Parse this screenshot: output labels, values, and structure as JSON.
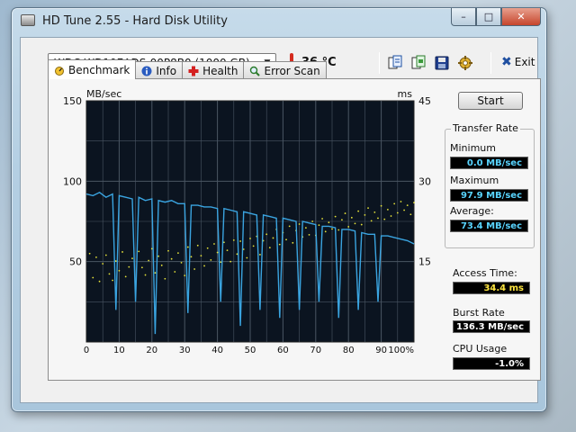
{
  "window": {
    "title": "HD Tune 2.55 - Hard Disk Utility",
    "controls": {
      "minimize": "–",
      "maximize": "□",
      "close": "✕"
    }
  },
  "toolbar": {
    "drive": "WDC WD10EADS-00P8B0 (1000 GB)",
    "temperature": "36 °C",
    "icons": [
      "copy-text-icon",
      "copy-screenshot-icon",
      "save-icon",
      "options-icon"
    ],
    "exit_label": "Exit"
  },
  "tabs": [
    {
      "label": "Benchmark",
      "icon": "benchmark-icon",
      "active": true
    },
    {
      "label": "Info",
      "icon": "info-icon",
      "active": false
    },
    {
      "label": "Health",
      "icon": "health-icon",
      "active": false
    },
    {
      "label": "Error Scan",
      "icon": "error-scan-icon",
      "active": false
    }
  ],
  "benchmark": {
    "start_label": "Start",
    "transfer_rate": {
      "title": "Transfer Rate",
      "minimum_label": "Minimum",
      "minimum_value": "0.0 MB/sec",
      "maximum_label": "Maximum",
      "maximum_value": "97.9 MB/sec",
      "average_label": "Average:",
      "average_value": "73.4 MB/sec"
    },
    "access_time_label": "Access Time:",
    "access_time_value": "34.4 ms",
    "burst_rate_label": "Burst Rate",
    "burst_rate_value": "136.3 MB/sec",
    "cpu_usage_label": "CPU Usage",
    "cpu_usage_value": "-1.0%"
  },
  "colors": {
    "plot_bg": "#0b1420",
    "grid": "#4a5663",
    "transfer_line": "#3aa4e0",
    "access_dots": "#e6e23a",
    "value_cyan": "#58d4ff",
    "value_yellow": "#ffe640",
    "value_white": "#ffffff"
  },
  "chart_data": {
    "type": "line",
    "left_axis_unit": "MB/sec",
    "right_axis_unit": "ms",
    "left_ticks": [
      "150",
      "100",
      "50"
    ],
    "right_ticks": [
      "45",
      "30",
      "15"
    ],
    "x_ticks": [
      "0",
      "10",
      "20",
      "30",
      "40",
      "50",
      "60",
      "70",
      "80",
      "90",
      "100%"
    ],
    "xlim": [
      0,
      100
    ],
    "ylim": [
      0,
      150
    ],
    "y2lim": [
      0,
      45
    ],
    "grid": true,
    "series": [
      {
        "x": [
          0,
          2,
          4,
          6,
          8,
          9,
          10,
          12,
          14,
          15,
          16,
          18,
          20,
          21,
          22,
          24,
          26,
          28,
          30,
          31,
          32,
          34,
          36,
          38,
          40,
          41,
          42,
          44,
          46,
          47,
          48,
          50,
          52,
          53,
          54,
          56,
          58,
          59,
          60,
          62,
          64,
          65,
          66,
          68,
          70,
          71,
          72,
          74,
          76,
          77,
          78,
          80,
          82,
          83,
          84,
          86,
          88,
          89,
          90,
          92,
          94,
          96,
          98,
          100
        ],
        "values": [
          92,
          91,
          93,
          90,
          92,
          20,
          91,
          90,
          89,
          25,
          90,
          88,
          89,
          5,
          88,
          87,
          88,
          86,
          86,
          18,
          85,
          85,
          84,
          84,
          83,
          25,
          83,
          82,
          81,
          10,
          81,
          80,
          79,
          20,
          79,
          78,
          77,
          15,
          77,
          76,
          75,
          20,
          75,
          74,
          73,
          25,
          72,
          72,
          71,
          15,
          70,
          70,
          69,
          20,
          68,
          67,
          67,
          25,
          66,
          66,
          65,
          64,
          63,
          61
        ]
      },
      {
        "points": [
          [
            1,
            16.5
          ],
          [
            2,
            12.0
          ],
          [
            3,
            15.8
          ],
          [
            4,
            11.3
          ],
          [
            5,
            14.6
          ],
          [
            6,
            16.2
          ],
          [
            7,
            12.7
          ],
          [
            8,
            11.5
          ],
          [
            9,
            15.1
          ],
          [
            10,
            13.3
          ],
          [
            11,
            16.8
          ],
          [
            12,
            12.2
          ],
          [
            13,
            14.0
          ],
          [
            14,
            15.6
          ],
          [
            15,
            11.0
          ],
          [
            16,
            16.9
          ],
          [
            17,
            13.9
          ],
          [
            18,
            12.5
          ],
          [
            19,
            15.2
          ],
          [
            20,
            17.4
          ],
          [
            21,
            12.9
          ],
          [
            22,
            16.0
          ],
          [
            23,
            14.3
          ],
          [
            24,
            11.8
          ],
          [
            25,
            17.0
          ],
          [
            26,
            15.5
          ],
          [
            27,
            13.1
          ],
          [
            28,
            16.6
          ],
          [
            29,
            14.8
          ],
          [
            30,
            12.4
          ],
          [
            31,
            17.7
          ],
          [
            32,
            15.9
          ],
          [
            33,
            13.6
          ],
          [
            34,
            18.0
          ],
          [
            35,
            16.1
          ],
          [
            36,
            14.2
          ],
          [
            37,
            17.5
          ],
          [
            38,
            15.3
          ],
          [
            39,
            18.3
          ],
          [
            40,
            16.7
          ],
          [
            41,
            14.9
          ],
          [
            42,
            18.6
          ],
          [
            43,
            17.1
          ],
          [
            44,
            15.0
          ],
          [
            45,
            19.0
          ],
          [
            46,
            16.4
          ],
          [
            47,
            18.8
          ],
          [
            48,
            17.3
          ],
          [
            49,
            15.7
          ],
          [
            50,
            19.3
          ],
          [
            51,
            17.9
          ],
          [
            52,
            19.7
          ],
          [
            53,
            16.3
          ],
          [
            54,
            18.9
          ],
          [
            55,
            20.1
          ],
          [
            56,
            17.6
          ],
          [
            57,
            19.4
          ],
          [
            58,
            21.0
          ],
          [
            59,
            18.2
          ],
          [
            60,
            20.4
          ],
          [
            61,
            19.1
          ],
          [
            62,
            21.6
          ],
          [
            63,
            18.5
          ],
          [
            64,
            20.8
          ],
          [
            65,
            22.0
          ],
          [
            66,
            19.6
          ],
          [
            67,
            21.3
          ],
          [
            68,
            20.0
          ],
          [
            69,
            22.5
          ],
          [
            70,
            19.9
          ],
          [
            71,
            21.8
          ],
          [
            72,
            23.0
          ],
          [
            73,
            20.6
          ],
          [
            74,
            22.3
          ],
          [
            75,
            21.1
          ],
          [
            76,
            23.4
          ],
          [
            77,
            20.9
          ],
          [
            78,
            22.8
          ],
          [
            79,
            24.0
          ],
          [
            80,
            21.5
          ],
          [
            81,
            23.2
          ],
          [
            82,
            22.1
          ],
          [
            83,
            24.4
          ],
          [
            84,
            21.9
          ],
          [
            85,
            23.7
          ],
          [
            86,
            25.0
          ],
          [
            87,
            22.6
          ],
          [
            88,
            24.2
          ],
          [
            89,
            23.1
          ],
          [
            90,
            25.4
          ],
          [
            91,
            22.9
          ],
          [
            92,
            24.7
          ],
          [
            93,
            23.5
          ],
          [
            94,
            25.8
          ],
          [
            95,
            24.1
          ],
          [
            96,
            26.2
          ],
          [
            97,
            24.6
          ],
          [
            98,
            25.5
          ],
          [
            99,
            23.8
          ],
          [
            100,
            26.0
          ]
        ]
      }
    ]
  }
}
